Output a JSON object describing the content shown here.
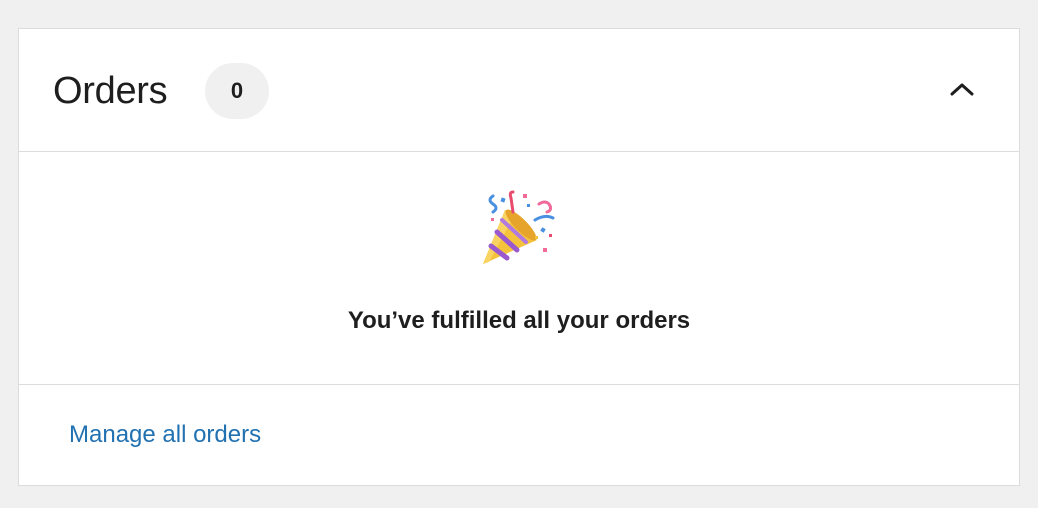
{
  "orders_card": {
    "title": "Orders",
    "count": "0",
    "collapse_icon": "chevron-up-icon",
    "celebration_icon": "party-popper-icon",
    "empty_message": "You’ve fulfilled all your orders",
    "manage_link_label": "Manage all orders"
  },
  "colors": {
    "background": "#f0f0f1",
    "card_border": "#dcdcde",
    "badge_background": "#f0f0f0",
    "link": "#2271b1",
    "text": "#1e1e1e"
  }
}
